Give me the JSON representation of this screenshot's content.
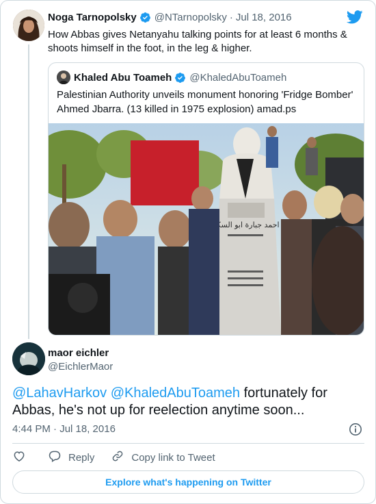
{
  "parent": {
    "name": "Noga Tarnopolsky",
    "handle": "@NTarnopolsky",
    "separator": "·",
    "date": "Jul 18, 2016",
    "text": "How Abbas gives Netanyahu talking points for at least 6 months & shoots himself in the foot, in the leg & higher."
  },
  "quoted": {
    "name": "Khaled Abu Toameh",
    "handle": "@KhaledAbuToameh",
    "text": "Palestinian Authority unveils monument honoring 'Fridge Bomber' Ahmed Jbarra. (13 killed in 1975 explosion) amad.ps",
    "monument_inscription": "احمد جبارة ابو السكر"
  },
  "reply": {
    "name": "maor eichler",
    "handle": "@EichlerMaor",
    "mention1": "@LahavHarkov",
    "mention2": "@KhaledAbuToameh",
    "text_part1": " fortunately for",
    "text_part2": "Abbas, he's not up for reelection anytime soon...",
    "timestamp": "4:44 PM · Jul 18, 2016"
  },
  "actions": {
    "reply_label": "Reply",
    "copy_label": "Copy link to Tweet"
  },
  "footer": {
    "explore_label": "Explore what's happening on Twitter"
  },
  "colors": {
    "accent": "#1d9bf0",
    "text": "#0f1419",
    "muted": "#536471",
    "border": "#cfd9de"
  },
  "icons": {
    "brand": "twitter-bird-icon",
    "verified": "verified-badge-icon",
    "info": "info-icon",
    "like": "heart-icon",
    "reply": "reply-bubble-icon",
    "copy": "link-icon"
  }
}
